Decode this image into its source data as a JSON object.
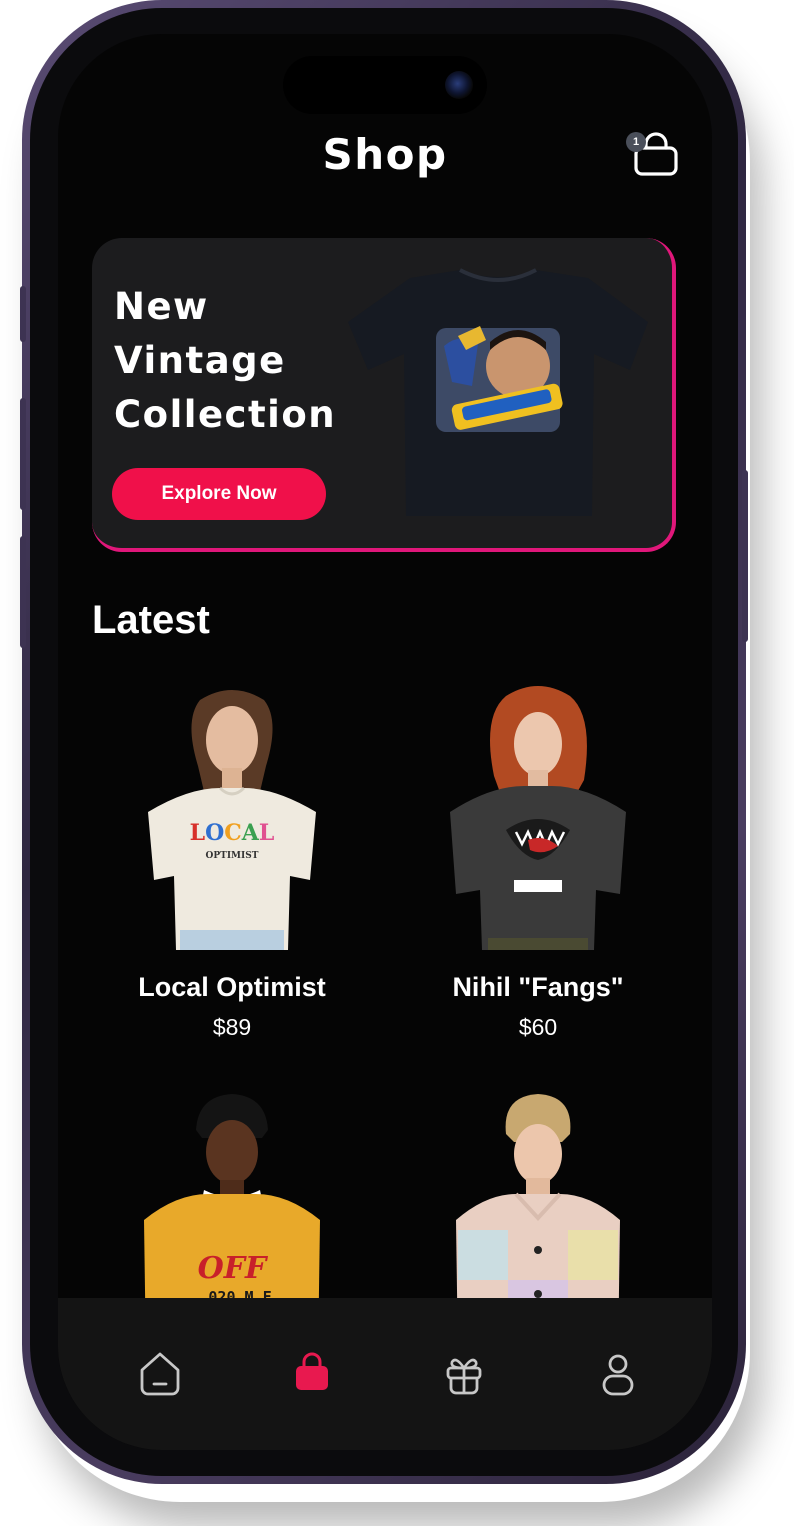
{
  "header": {
    "title": "Shop",
    "cart_count": "1"
  },
  "promo": {
    "title_lines": [
      "New",
      "Vintage",
      "Collection"
    ],
    "button_label": "Explore Now",
    "accent_color": "#e0177a",
    "button_color": "#f0104a"
  },
  "latest": {
    "heading": "Latest",
    "products": [
      {
        "name": "Local Optimist",
        "price": "$89",
        "shirt_color": "#efeadf",
        "graphic": "LOCAL"
      },
      {
        "name": "Nihil \"Fangs\"",
        "price": "$60",
        "shirt_color": "#3a3a3a"
      },
      {
        "name": "",
        "price": "",
        "shirt_color": "#e8a92a",
        "graphic": "OFF"
      },
      {
        "name": "",
        "price": "",
        "shirt_color": "#e9cfc2"
      }
    ]
  },
  "nav": {
    "items": [
      {
        "icon": "home-icon",
        "active": false
      },
      {
        "icon": "shopping-bag-icon",
        "active": true
      },
      {
        "icon": "gift-icon",
        "active": false
      },
      {
        "icon": "profile-icon",
        "active": false
      }
    ],
    "active_color": "#e8194f"
  }
}
